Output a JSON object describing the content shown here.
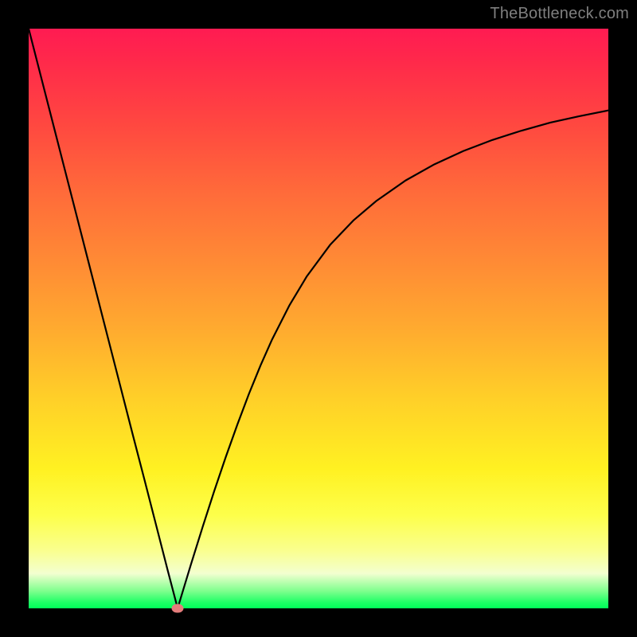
{
  "source_label": "TheBottleneck.com",
  "chart_data": {
    "type": "line",
    "title": "",
    "xlabel": "",
    "ylabel": "",
    "xlim": [
      0,
      100
    ],
    "ylim": [
      0,
      100
    ],
    "grid": false,
    "x": [
      0,
      2,
      4,
      6,
      8,
      10,
      12,
      14,
      16,
      18,
      20,
      22,
      24,
      25.7,
      26,
      28,
      30,
      32,
      34,
      36,
      38,
      40,
      42,
      45,
      48,
      52,
      56,
      60,
      65,
      70,
      75,
      80,
      85,
      90,
      95,
      100
    ],
    "y": [
      100,
      92.2,
      84.4,
      76.6,
      68.8,
      61.0,
      53.2,
      45.4,
      37.6,
      29.8,
      22.1,
      14.3,
      6.5,
      0,
      1.0,
      7.6,
      14.0,
      20.2,
      26.1,
      31.7,
      37.0,
      41.9,
      46.4,
      52.3,
      57.3,
      62.7,
      66.9,
      70.3,
      73.8,
      76.6,
      78.9,
      80.8,
      82.4,
      83.8,
      84.9,
      85.9
    ],
    "marker": {
      "x": 25.7,
      "y": 0
    },
    "background_gradient": {
      "orientation": "vertical",
      "stops": [
        {
          "pos": 0.0,
          "color": "#ff1b52"
        },
        {
          "pos": 0.25,
          "color": "#ff6a3a"
        },
        {
          "pos": 0.5,
          "color": "#ffab2f"
        },
        {
          "pos": 0.78,
          "color": "#fff122"
        },
        {
          "pos": 0.97,
          "color": "#7fff8e"
        },
        {
          "pos": 1.0,
          "color": "#00ff59"
        }
      ]
    }
  }
}
